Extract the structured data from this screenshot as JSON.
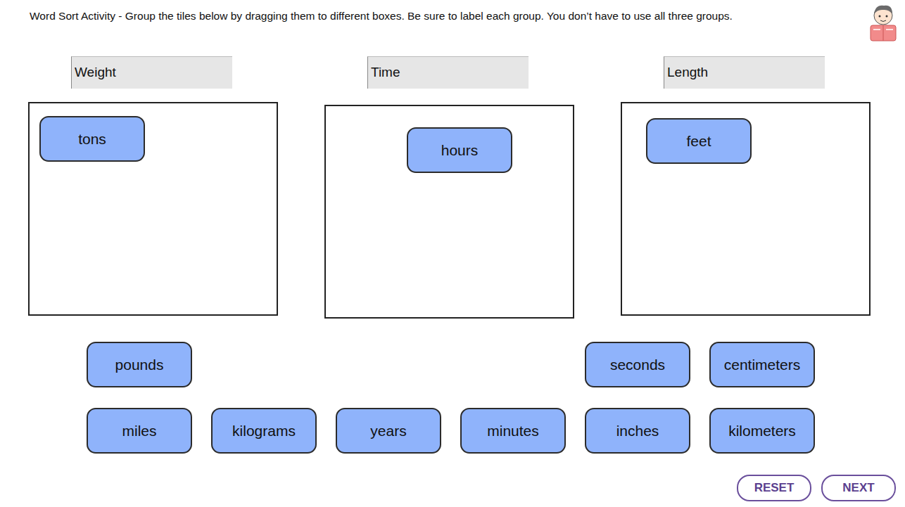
{
  "instruction": "Word Sort Activity - Group the tiles below by dragging them to different boxes. Be sure to label each group. You don’t have to use all three groups.",
  "groups": [
    {
      "label": "Weight",
      "tiles": [
        "tons"
      ]
    },
    {
      "label": "Time",
      "tiles": [
        "hours"
      ]
    },
    {
      "label": "Length",
      "tiles": [
        "feet"
      ]
    }
  ],
  "pool": [
    "pounds",
    "seconds",
    "centimeters",
    "miles",
    "kilograms",
    "years",
    "minutes",
    "inches",
    "kilometers"
  ],
  "buttons": [
    "RESET",
    "NEXT"
  ]
}
